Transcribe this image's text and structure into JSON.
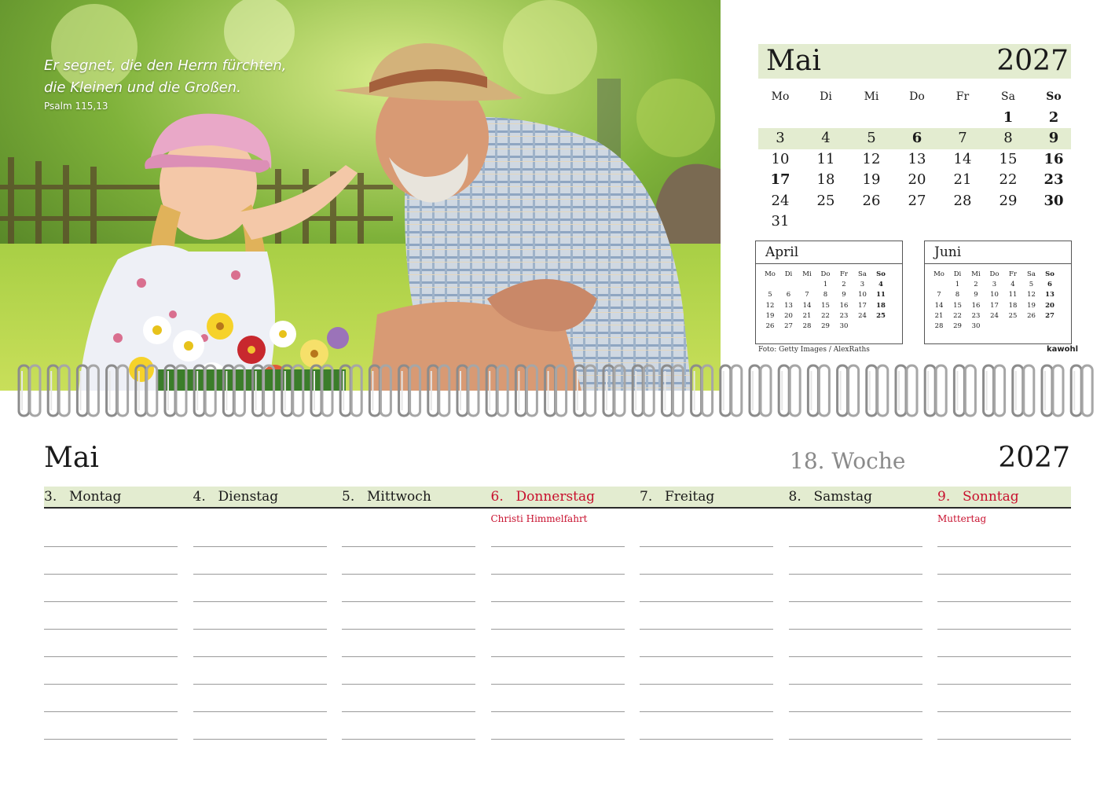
{
  "photo": {
    "quote_lines": [
      "Er segnet, die den Herrn fürchten,",
      "die Kleinen und die Großen."
    ],
    "quote_reference": "Psalm 115,13",
    "credit": "Foto: Getty Images / AlexRaths",
    "brand": "kawohl"
  },
  "month_calendar": {
    "month": "Mai",
    "year": "2027",
    "weekdays": [
      "Mo",
      "Di",
      "Mi",
      "Do",
      "Fr",
      "Sa",
      "So"
    ],
    "weeks": [
      [
        "",
        "",
        "",
        "",
        "",
        "1",
        "2"
      ],
      [
        "3",
        "4",
        "5",
        "6",
        "7",
        "8",
        "9"
      ],
      [
        "10",
        "11",
        "12",
        "13",
        "14",
        "15",
        "16"
      ],
      [
        "17",
        "18",
        "19",
        "20",
        "21",
        "22",
        "23"
      ],
      [
        "24",
        "25",
        "26",
        "27",
        "28",
        "29",
        "30"
      ],
      [
        "31",
        "",
        "",
        "",
        "",
        "",
        ""
      ]
    ],
    "highlight_week_index": 1,
    "bold_days": [
      "1",
      "2",
      "6",
      "9",
      "16",
      "17",
      "23",
      "30"
    ]
  },
  "mini_calendars": [
    {
      "month": "April",
      "weekdays": [
        "Mo",
        "Di",
        "Mi",
        "Do",
        "Fr",
        "Sa",
        "So"
      ],
      "weeks": [
        [
          "",
          "",
          "",
          "1",
          "2",
          "3",
          "4"
        ],
        [
          "5",
          "6",
          "7",
          "8",
          "9",
          "10",
          "11"
        ],
        [
          "12",
          "13",
          "14",
          "15",
          "16",
          "17",
          "18"
        ],
        [
          "19",
          "20",
          "21",
          "22",
          "23",
          "24",
          "25"
        ],
        [
          "26",
          "27",
          "28",
          "29",
          "30",
          "",
          ""
        ]
      ],
      "bold_days": [
        "4",
        "11",
        "18",
        "25"
      ]
    },
    {
      "month": "Juni",
      "weekdays": [
        "Mo",
        "Di",
        "Mi",
        "Do",
        "Fr",
        "Sa",
        "So"
      ],
      "weeks": [
        [
          "",
          "1",
          "2",
          "3",
          "4",
          "5",
          "6"
        ],
        [
          "7",
          "8",
          "9",
          "10",
          "11",
          "12",
          "13"
        ],
        [
          "14",
          "15",
          "16",
          "17",
          "18",
          "19",
          "20"
        ],
        [
          "21",
          "22",
          "23",
          "24",
          "25",
          "26",
          "27"
        ],
        [
          "28",
          "29",
          "30",
          "",
          "",
          "",
          ""
        ]
      ],
      "bold_days": [
        "6",
        "13",
        "20",
        "27"
      ]
    }
  ],
  "week_planner": {
    "month": "Mai",
    "week_label": "18. Woche",
    "year": "2027",
    "days": [
      {
        "num": "3.",
        "name": "Montag",
        "holiday": "",
        "red": false
      },
      {
        "num": "4.",
        "name": "Dienstag",
        "holiday": "",
        "red": false
      },
      {
        "num": "5.",
        "name": "Mittwoch",
        "holiday": "",
        "red": false
      },
      {
        "num": "6.",
        "name": "Donnerstag",
        "holiday": "Christi Himmelfahrt",
        "red": true
      },
      {
        "num": "7.",
        "name": "Freitag",
        "holiday": "",
        "red": false
      },
      {
        "num": "8.",
        "name": "Samstag",
        "holiday": "",
        "red": false
      },
      {
        "num": "9.",
        "name": "Sonntag",
        "holiday": "Muttertag",
        "red": true
      }
    ]
  },
  "colors": {
    "accent_green": "#e3ecd0",
    "holiday_red": "#c8102e"
  }
}
